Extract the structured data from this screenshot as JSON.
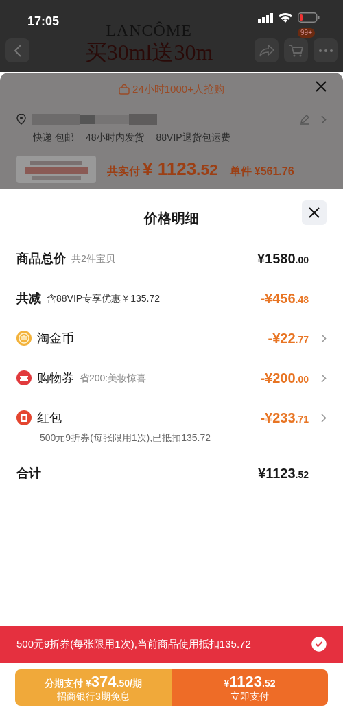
{
  "status_bar": {
    "time": "17:05"
  },
  "background_page": {
    "brand": "LANCÔME",
    "headline": "买30ml送30m",
    "cart_badge": "99+",
    "popularity": "24小时1000+人抢购",
    "shipping_tags": [
      "快递 包邮",
      "48小时内发货",
      "88VIP退货包运费"
    ],
    "product": {
      "kind": "picture",
      "total_label": "共实付",
      "total_amount": "¥ 1123.52",
      "unit_label": "单件",
      "unit_price": "¥561.76"
    }
  },
  "price_detail": {
    "title": "价格明细",
    "rows": [
      {
        "kind": "total",
        "label": "商品总价",
        "note": "共2件宝贝",
        "amount": "¥1580.00"
      },
      {
        "kind": "reduction",
        "label": "共减",
        "note": "含88VIP专享优惠￥135.72",
        "amount": "-¥456.48"
      },
      {
        "kind": "coin",
        "label": "淘金币",
        "amount": "-¥22.77"
      },
      {
        "kind": "coupon",
        "label": "购物券",
        "note": "省200:美妆惊喜",
        "amount": "-¥200.00"
      },
      {
        "kind": "red_packet",
        "label": "红包",
        "amount": "-¥233.71",
        "detail": "500元9折券(每张限用1次),已抵扣135.72"
      },
      {
        "kind": "sum",
        "label": "合计",
        "amount": "¥1123.52"
      }
    ]
  },
  "coupon_banner": {
    "text": "500元9折券(每张限用1次),当前商品使用抵扣135.72",
    "checked": true
  },
  "pay_bar": {
    "installment": {
      "label": "分期支付",
      "amount": "¥374.50",
      "unit": "/期",
      "sub": "招商银行3期免息"
    },
    "pay_now": {
      "amount": "¥1123.52",
      "label": "立即支付"
    }
  }
}
